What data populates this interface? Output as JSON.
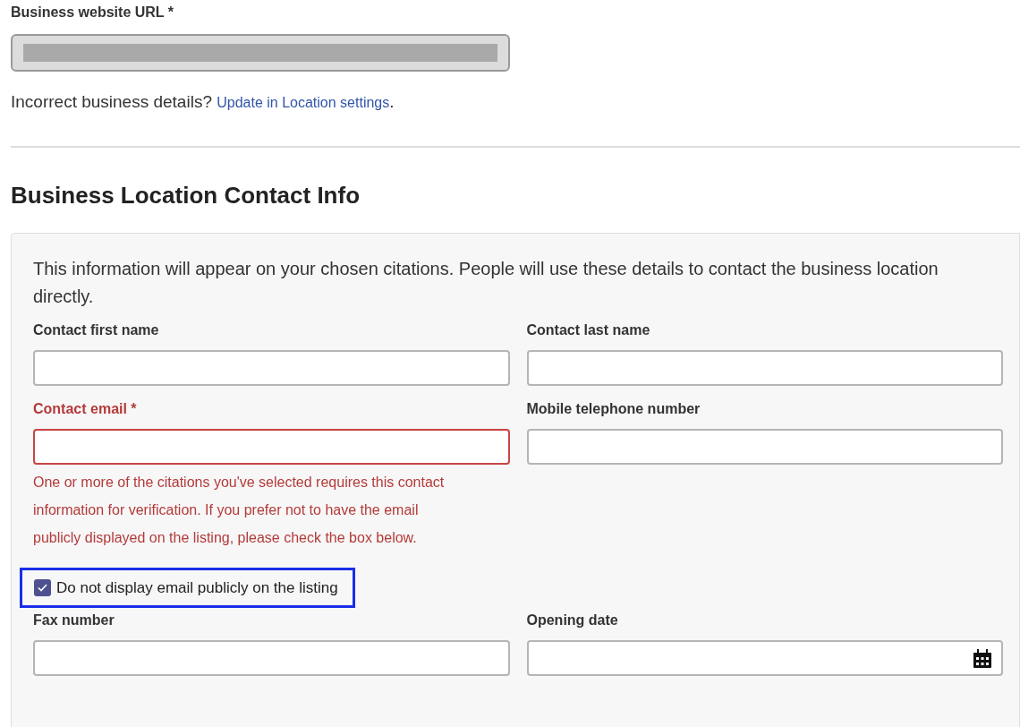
{
  "website": {
    "label": "Business website URL *",
    "disabled": true
  },
  "notice": {
    "text": "Incorrect business details?",
    "link": "Update in Location settings",
    "trailing": "."
  },
  "section": {
    "title": "Business Location Contact Info"
  },
  "panel": {
    "intro": "This information will appear on your chosen citations. People will use these details to contact the business location directly.",
    "rows": [
      {
        "kind": "fields",
        "fields": [
          {
            "label": "Contact first name",
            "kind": "text",
            "invalid": false
          },
          {
            "label": "Contact last name",
            "kind": "text",
            "invalid": false
          }
        ]
      },
      {
        "kind": "fields",
        "fields": [
          {
            "label": "Contact email *",
            "kind": "text",
            "invalid": true,
            "error": "One or more of the citations you've selected requires this contact information for verification. If you prefer not to have the email publicly displayed on the listing, please check the box below."
          },
          {
            "label": "Mobile telephone number",
            "kind": "text",
            "invalid": false
          }
        ]
      },
      {
        "kind": "checkbox",
        "label": "Do not display email publicly on the listing",
        "checked": true,
        "highlighted": true
      },
      {
        "kind": "fields",
        "fields": [
          {
            "label": "Fax number",
            "kind": "text",
            "invalid": false
          },
          {
            "label": "Opening date",
            "kind": "date",
            "invalid": false
          }
        ]
      }
    ]
  }
}
